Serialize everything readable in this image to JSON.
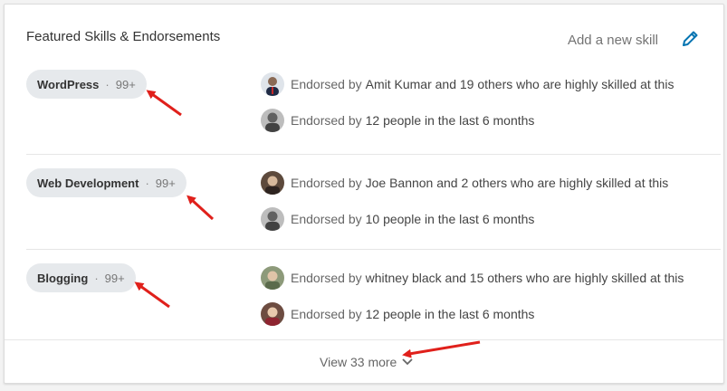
{
  "card": {
    "title": "Featured Skills & Endorsements",
    "add_skill_label": "Add a new skill"
  },
  "skills": [
    {
      "name": "WordPress",
      "count": "99+",
      "endorsements": [
        {
          "prefix": "Endorsed by",
          "text": "Amit Kumar and 19 others who are highly skilled at this"
        },
        {
          "prefix": "Endorsed by",
          "text": "12 people in the last 6 months"
        }
      ]
    },
    {
      "name": "Web Development",
      "count": "99+",
      "endorsements": [
        {
          "prefix": "Endorsed by",
          "text": "Joe Bannon and 2 others who are highly skilled at this"
        },
        {
          "prefix": "Endorsed by",
          "text": "10 people in the last 6 months"
        }
      ]
    },
    {
      "name": "Blogging",
      "count": "99+",
      "endorsements": [
        {
          "prefix": "Endorsed by",
          "text": "whitney black and 15 others who are highly skilled at this"
        },
        {
          "prefix": "Endorsed by",
          "text": "12 people in the last 6 months"
        }
      ]
    }
  ],
  "footer": {
    "view_more_label": "View 33 more"
  },
  "colors": {
    "pill_bg": "#e6e9ec",
    "accent_blue": "#0073b1",
    "annotation_red": "#e0201b"
  },
  "icons": [
    "pencil-icon",
    "chevron-down-icon",
    "avatar"
  ]
}
